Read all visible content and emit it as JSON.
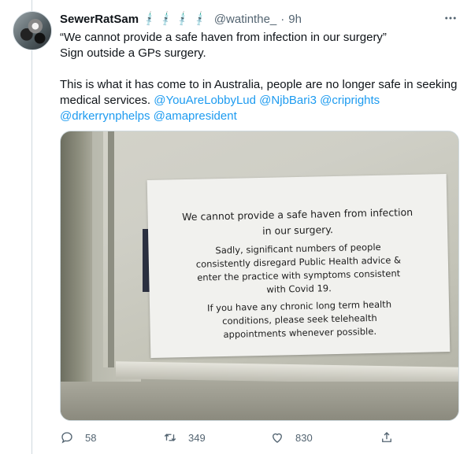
{
  "tweet": {
    "author_name": "SewerRatSam",
    "name_emoji": [
      "💉",
      "💉",
      "💉",
      "💉"
    ],
    "handle": "@watinthe_",
    "separator": "·",
    "time": "9h",
    "text_line1": "“We cannot provide a safe haven from infection in our surgery”",
    "text_line2": "Sign outside a GPs surgery.",
    "text_line3": "This is what it has come to in Australia, people are no longer safe in seeking medical services.",
    "mentions": [
      "@YouAreLobbyLud",
      "@NjbBari3",
      "@cripright s"
    ],
    "mentions2": [
      "@drkerrynphelps",
      "@amapresident"
    ]
  },
  "sign": {
    "heading1": "We cannot provide a safe haven from infection",
    "heading2": "in our surgery.",
    "body1": "Sadly, significant numbers of people",
    "body2": "consistently disregard Public Health advice &",
    "body3": "enter the practice with symptoms consistent",
    "body4": "with Covid 19.",
    "body5": "If you have any chronic long term health",
    "body6": "conditions, please seek telehealth",
    "body7": "appointments whenever possible."
  },
  "actions": {
    "reply_count": "58",
    "retweet_count": "349",
    "like_count": "830"
  },
  "icons": {
    "more": "more-icon",
    "reply": "reply-icon",
    "retweet": "retweet-icon",
    "like": "heart-icon",
    "share": "share-icon"
  },
  "colors": {
    "link": "#1d9bf0",
    "secondary": "#536471"
  }
}
